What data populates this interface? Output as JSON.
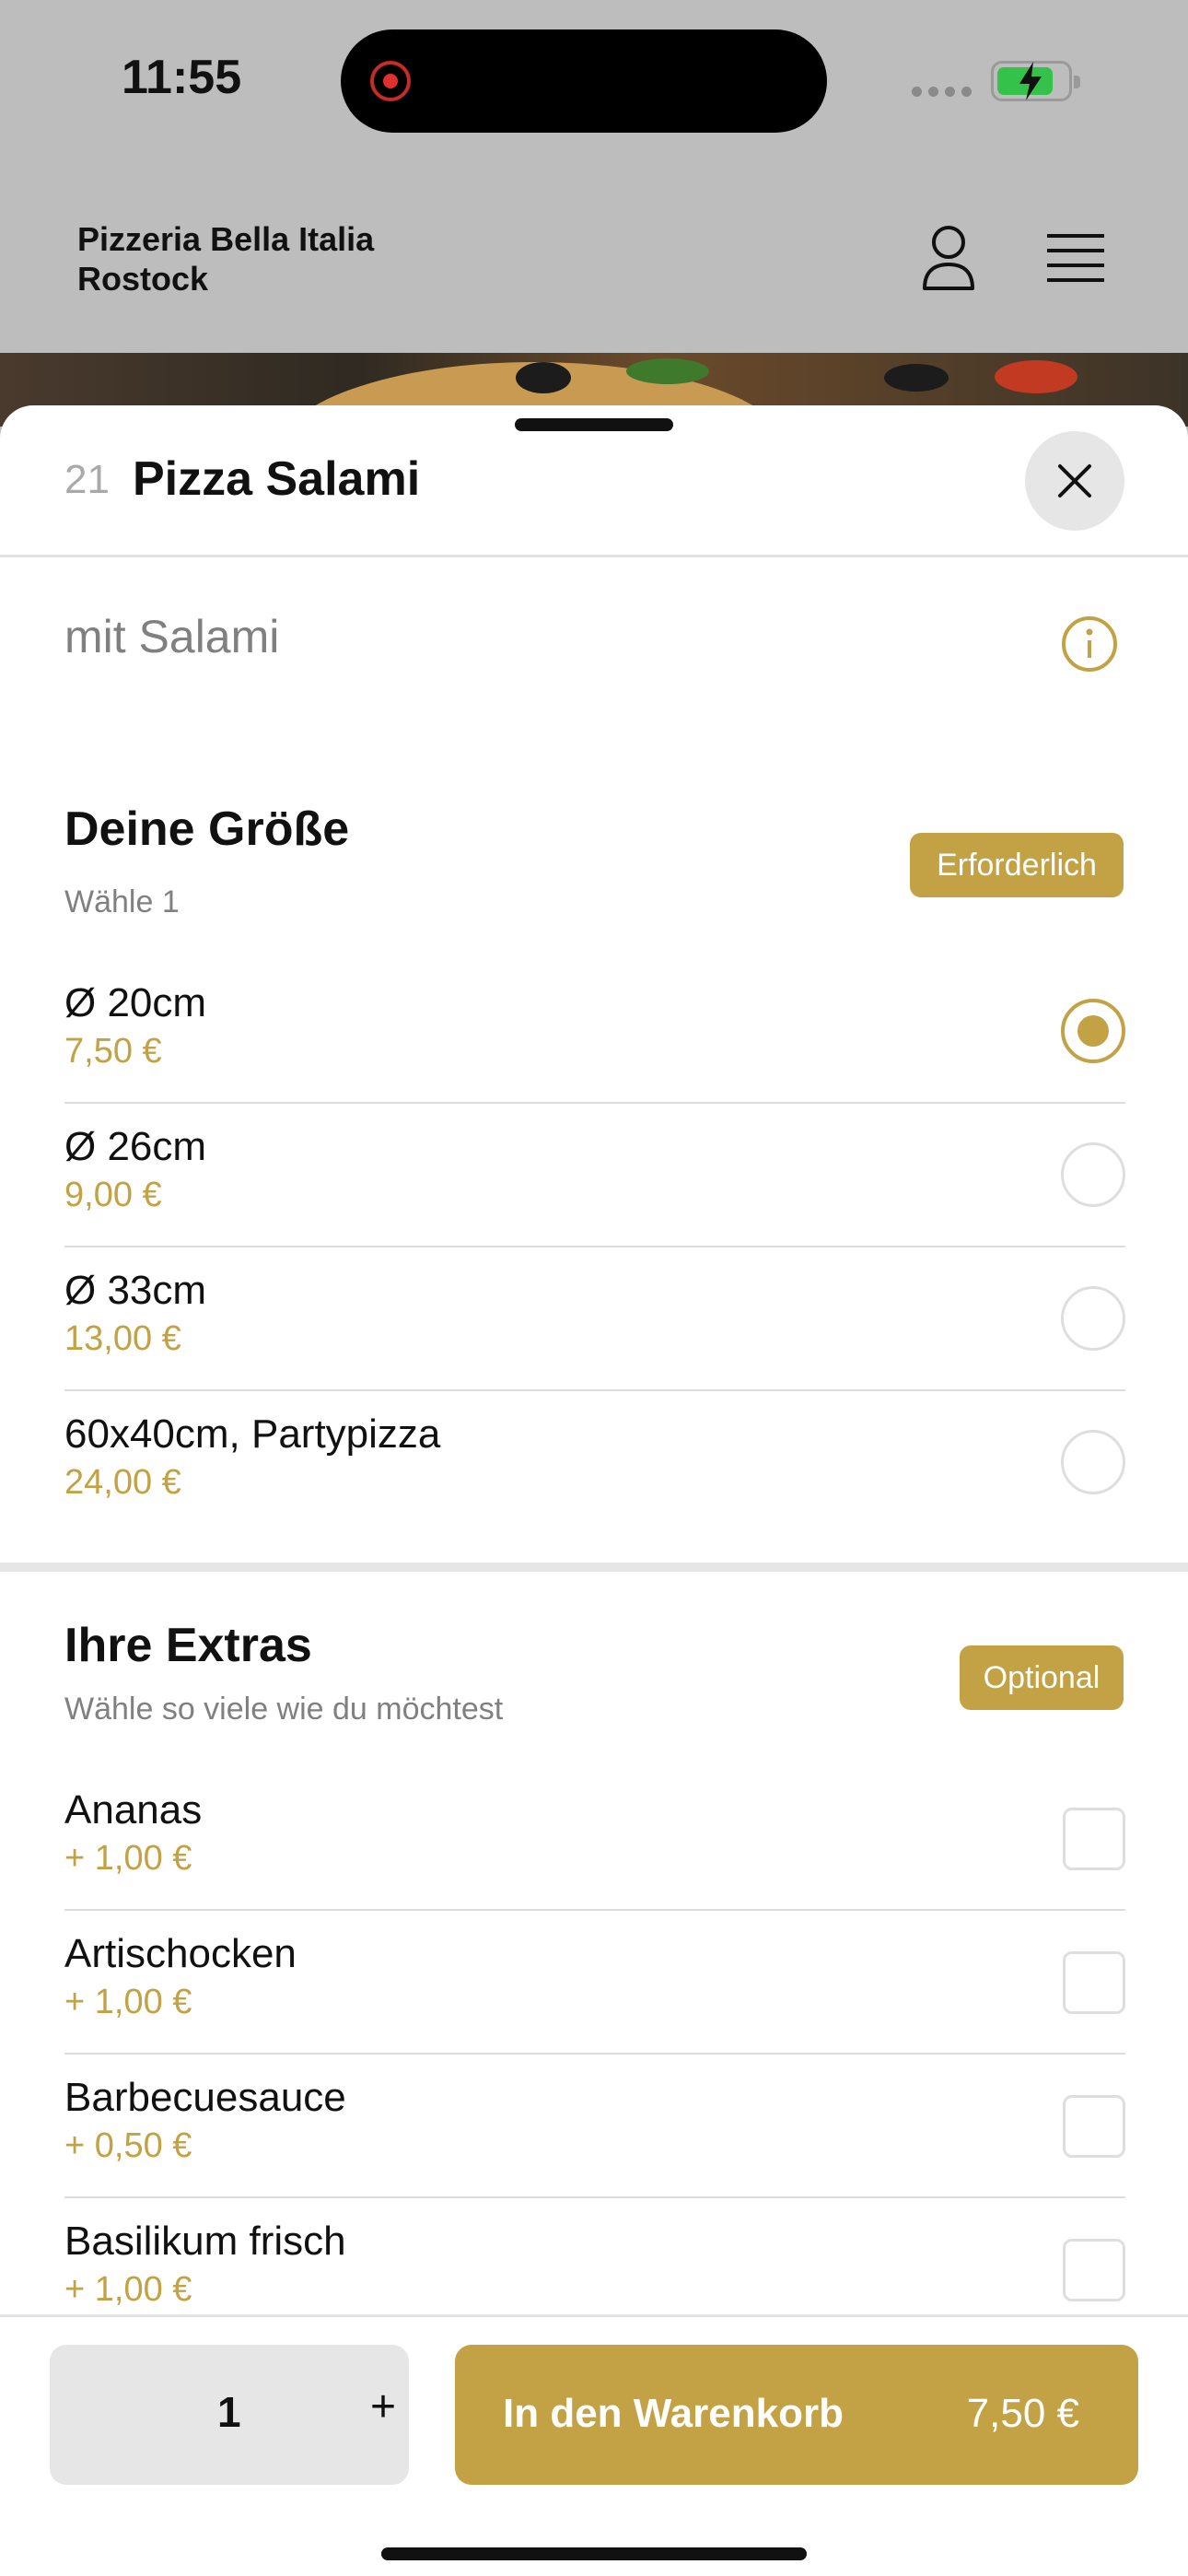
{
  "status_bar": {
    "time": "11:55"
  },
  "header": {
    "restaurant_line1": "Pizzeria Bella Italia",
    "restaurant_line2": "Rostock",
    "icons": [
      "user-icon",
      "menu-icon"
    ]
  },
  "item": {
    "number": "21",
    "title": "Pizza Salami",
    "description": "mit Salami"
  },
  "sizes": {
    "title": "Deine Größe",
    "subtitle": "Wähle 1",
    "badge": "Erforderlich",
    "options": [
      {
        "name": "Ø 20cm",
        "price": "7,50 €",
        "selected": true
      },
      {
        "name": "Ø 26cm",
        "price": "9,00 €",
        "selected": false
      },
      {
        "name": "Ø 33cm",
        "price": "13,00 €",
        "selected": false
      },
      {
        "name": "60x40cm, Partypizza",
        "price": "24,00 €",
        "selected": false
      }
    ]
  },
  "extras": {
    "title": "Ihre Extras",
    "subtitle": "Wähle so viele wie du möchtest",
    "badge": "Optional",
    "options": [
      {
        "name": "Ananas",
        "price": "+ 1,00 €",
        "checked": false
      },
      {
        "name": "Artischocken",
        "price": "+ 1,00 €",
        "checked": false
      },
      {
        "name": "Barbecuesauce",
        "price": "+ 0,50 €",
        "checked": false
      },
      {
        "name": "Basilikum frisch",
        "price": "+ 1,00 €",
        "checked": false
      }
    ]
  },
  "footer": {
    "quantity": "1",
    "plus": "+",
    "cart_label": "In den Warenkorb",
    "cart_total": "7,50 €"
  },
  "colors": {
    "accent": "#c2a244",
    "backdrop": "#bdbdbd"
  }
}
